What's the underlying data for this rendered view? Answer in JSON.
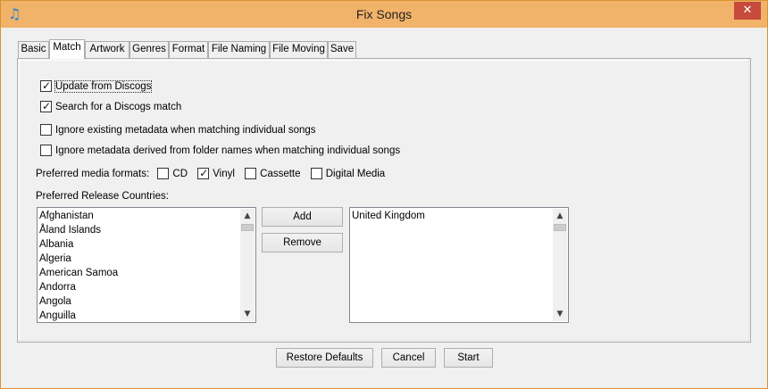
{
  "window": {
    "title": "Fix Songs",
    "app_icon": "music-note-icon",
    "close_glyph": "✕"
  },
  "tabs": [
    {
      "label": "Basic",
      "active": false
    },
    {
      "label": "Match",
      "active": true
    },
    {
      "label": "Artwork",
      "active": false
    },
    {
      "label": "Genres",
      "active": false
    },
    {
      "label": "Format",
      "active": false
    },
    {
      "label": "File Naming",
      "active": false
    },
    {
      "label": "File Moving",
      "active": false
    },
    {
      "label": "Save",
      "active": false
    }
  ],
  "options": {
    "update_from_discogs": {
      "label": "Update from Discogs",
      "checked": true
    },
    "search_discogs_match": {
      "label": "Search for a Discogs match",
      "checked": true
    },
    "ignore_existing_metadata": {
      "label": "Ignore existing metadata when matching individual songs",
      "checked": false
    },
    "ignore_folder_metadata": {
      "label": "Ignore metadata derived from folder names when matching individual songs",
      "checked": false
    }
  },
  "media_formats": {
    "label": "Preferred media formats:",
    "items": [
      {
        "label": "CD",
        "checked": false
      },
      {
        "label": "Vinyl",
        "checked": true
      },
      {
        "label": "Cassette",
        "checked": false
      },
      {
        "label": "Digital Media",
        "checked": false
      }
    ]
  },
  "countries": {
    "label": "Preferred Release Countries:",
    "available": [
      "Afghanistan",
      "Åland Islands",
      "Albania",
      "Algeria",
      "American Samoa",
      "Andorra",
      "Angola",
      "Anguilla"
    ],
    "selected": [
      "United Kingdom"
    ],
    "add_label": "Add",
    "remove_label": "Remove"
  },
  "footer": {
    "restore_label": "Restore Defaults",
    "cancel_label": "Cancel",
    "start_label": "Start"
  },
  "colors": {
    "titlebar": "#f1b26a",
    "close_button": "#c74a3c"
  }
}
